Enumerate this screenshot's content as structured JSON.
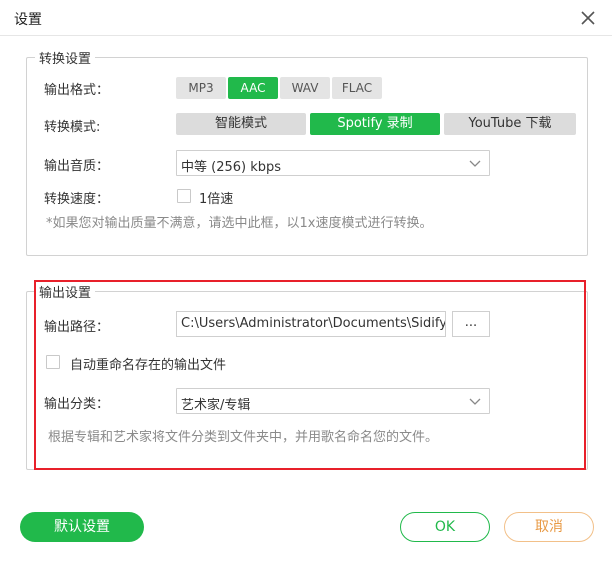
{
  "window": {
    "title": "设置"
  },
  "conversion": {
    "legend": "转换设置",
    "format_label": "输出格式：",
    "formats": [
      "MP3",
      "AAC",
      "WAV",
      "FLAC"
    ],
    "selected_format": "AAC",
    "mode_label": "转换模式:",
    "modes": [
      "智能模式",
      "Spotify 录制",
      "YouTube 下载"
    ],
    "selected_mode": "Spotify 录制",
    "quality_label": "输出音质：",
    "quality_value": "中等 (256) kbps",
    "speed_label": "转换速度：",
    "speed_option": "1倍速",
    "speed_checked": false,
    "speed_hint": "*如果您对输出质量不满意，请选中此框，以1x速度模式进行转换。"
  },
  "output": {
    "legend": "输出设置",
    "path_label": "输出路径：",
    "path_value": "C:\\Users\\Administrator\\Documents\\Sidify M",
    "browse_label": "...",
    "rename_label": "自动重命名存在的输出文件",
    "rename_checked": false,
    "category_label": "输出分类：",
    "category_value": "艺术家/专辑",
    "category_hint": "根据专辑和艺术家将文件分类到文件夹中，并用歌名命名您的文件。"
  },
  "buttons": {
    "default": "默认设置",
    "ok": "OK",
    "cancel": "取消"
  },
  "colors": {
    "accent": "#21b94b",
    "highlight_border": "#e8202a",
    "cancel": "#e89a45"
  }
}
